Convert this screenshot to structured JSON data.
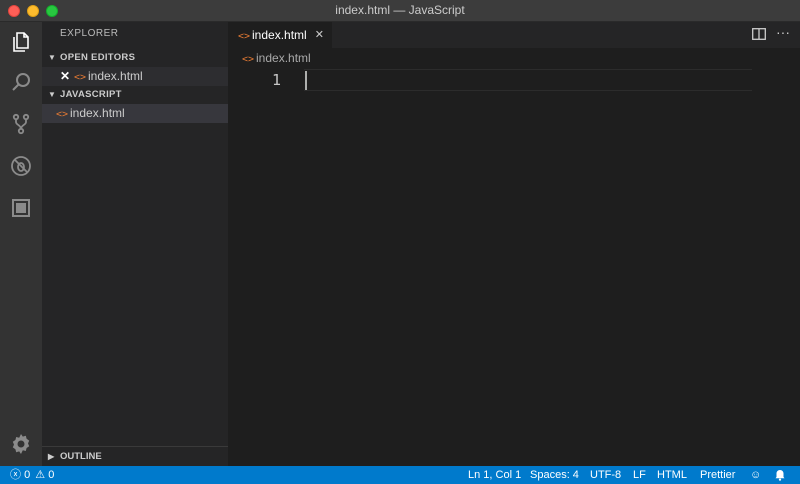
{
  "window": {
    "title": "index.html — JavaScript"
  },
  "activity_bar": {
    "items": [
      "files-icon",
      "search-icon",
      "source-control-icon",
      "debug-icon",
      "extensions-icon"
    ],
    "settings": "gear-icon"
  },
  "sidebar": {
    "header": "EXPLORER",
    "open_editors": {
      "title": "OPEN EDITORS",
      "items": [
        {
          "label": "index.html"
        }
      ]
    },
    "folder": {
      "title": "JAVASCRIPT",
      "items": [
        {
          "label": "index.html"
        }
      ]
    },
    "outline": {
      "title": "OUTLINE"
    }
  },
  "editor": {
    "tabs": [
      {
        "label": "index.html",
        "close": "✕"
      }
    ],
    "breadcrumb": "index.html",
    "line_number": "1",
    "more": "···"
  },
  "statusbar": {
    "errors": "0",
    "warnings": "0",
    "position": "Ln 1, Col 1",
    "spaces": "Spaces: 4",
    "encoding": "UTF-8",
    "eol": "LF",
    "language": "HTML",
    "formatter": "Prettier"
  },
  "colors": {
    "accent": "#007acc",
    "html_icon": "#e37933"
  }
}
